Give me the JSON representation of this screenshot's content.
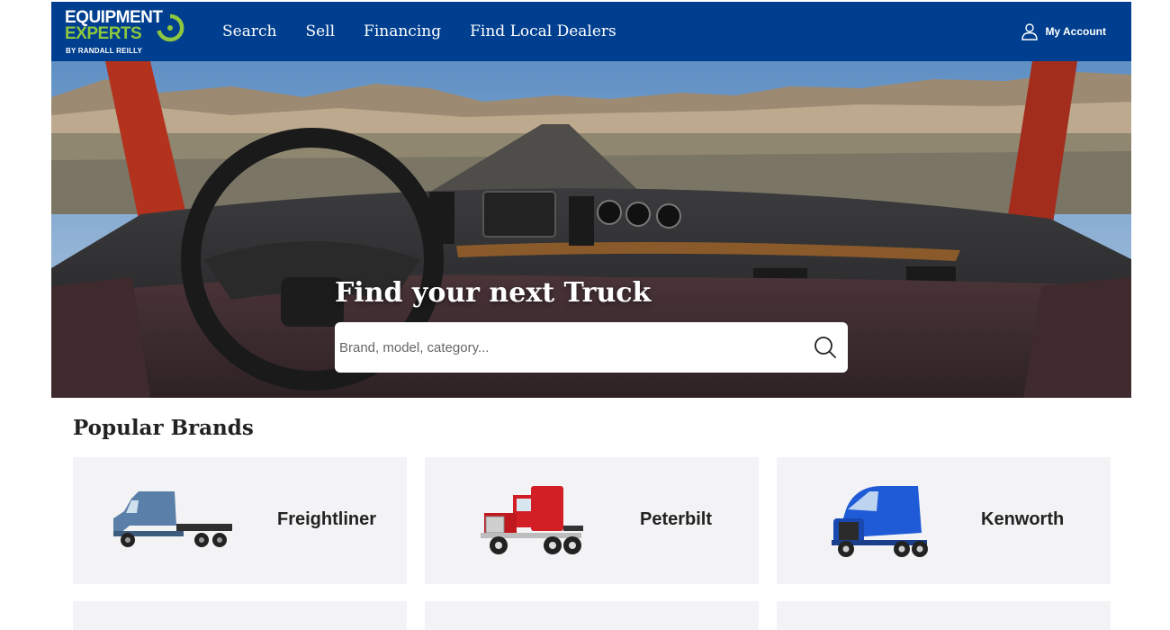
{
  "header": {
    "logo": {
      "line1": "EQUIPMENT",
      "line2": "EXPERTS",
      "sub": "BY RANDALL REILLY"
    },
    "nav": [
      {
        "label": "Search"
      },
      {
        "label": "Sell"
      },
      {
        "label": "Financing"
      },
      {
        "label": "Find Local Dealers"
      }
    ],
    "account_label": "My Account"
  },
  "hero": {
    "title": "Find your next Truck",
    "search_placeholder": "Brand, model, category..."
  },
  "brands": {
    "title": "Popular Brands",
    "items": [
      {
        "name": "Freightliner",
        "truck_color": "#5a7fa8"
      },
      {
        "name": "Peterbilt",
        "truck_color": "#d21f26"
      },
      {
        "name": "Kenworth",
        "truck_color": "#1f5bd6"
      }
    ]
  },
  "colors": {
    "header_bg": "#003f8f",
    "logo_green": "#8dc63f",
    "card_bg": "#f3f3f5"
  }
}
